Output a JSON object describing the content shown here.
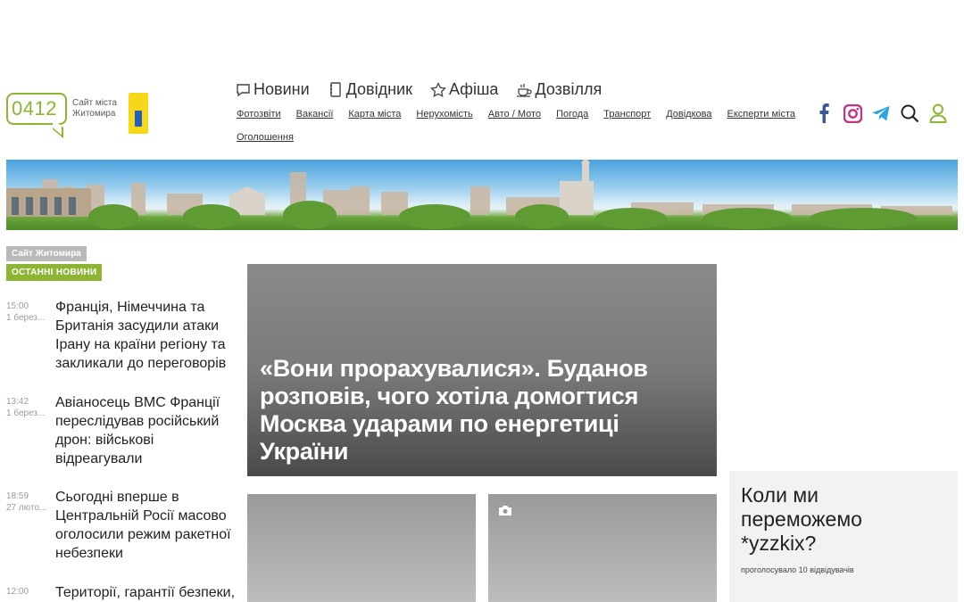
{
  "logo": {
    "number": "0412",
    "text": "Сайт міста Житомира"
  },
  "main_nav": [
    {
      "label": "Новини",
      "icon": "speech-bubble-icon"
    },
    {
      "label": "Довідник",
      "icon": "notebook-icon"
    },
    {
      "label": "Афіша",
      "icon": "star-icon"
    },
    {
      "label": "Дозвілля",
      "icon": "coffee-cup-icon"
    }
  ],
  "sub_nav": [
    "Фотозвіти",
    "Вакансії",
    "Карта міста",
    "Нерухомість",
    "Авто / Мото",
    "Погода",
    "Транспорт",
    "Довідкова",
    "Експерти міста",
    "Оголошення"
  ],
  "tools": [
    "facebook-icon",
    "instagram-icon",
    "telegram-icon",
    "search-icon",
    "user-icon"
  ],
  "colors": {
    "accent": "#8cb534",
    "facebook": "#3b5998",
    "instagram": "#c13584",
    "telegram": "#2ca5e0"
  },
  "sidebar": {
    "site_tag": "Сайт Житомира",
    "latest_tag": "ОСТАННІ НОВИНИ",
    "news": [
      {
        "time": "15:00",
        "date": "1 берез...",
        "title": "Франція, Німеччина та Британія засудили атаки Ірану на країни регіону та закликали до переговорів"
      },
      {
        "time": "13:42",
        "date": "1 берез...",
        "title": "Авіаносець ВМС Франції переслідував російський дрон: військові відреагували"
      },
      {
        "time": "18:59",
        "date": "27 люто...",
        "title": "Сьогодні вперше в Центральній Росії масово оголосили режим ракетної небезпеки"
      },
      {
        "time": "12:00",
        "date": "",
        "title": "Території, гарантії безпеки,"
      }
    ]
  },
  "hero": {
    "title": "«Вони прорахувалися». Буданов розповів, чого хотіла домогтися Москва ударами по енергетиці України"
  },
  "poll": {
    "question": "Коли ми переможемо *yzzkix?",
    "votes_text": "проголосувало 10 відвідувачів"
  }
}
